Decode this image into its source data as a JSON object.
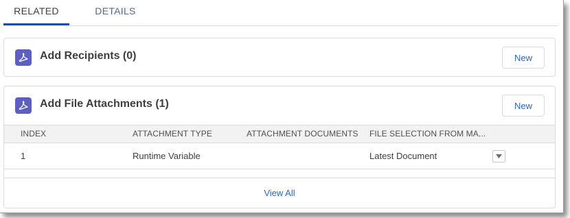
{
  "tabs": [
    {
      "label": "RELATED",
      "active": true
    },
    {
      "label": "DETAILS",
      "active": false
    }
  ],
  "recipients_card": {
    "title": "Add Recipients (0)",
    "icon": "pdf-icon",
    "new_label": "New"
  },
  "attachments_card": {
    "title": "Add File Attachments (1)",
    "icon": "pdf-icon",
    "new_label": "New",
    "columns": [
      "INDEX",
      "ATTACHMENT TYPE",
      "ATTACHMENT DOCUMENTS",
      "FILE SELECTION FROM MA..."
    ],
    "rows": [
      {
        "index": "1",
        "attachment_type": "Runtime Variable",
        "attachment_documents": "",
        "file_selection": "Latest Document"
      }
    ],
    "view_all_label": "View All"
  },
  "colors": {
    "accent": "#1b5297",
    "icon_bg": "#5d5fbf",
    "link": "#2a68b8",
    "header_bg": "#f3f2f2",
    "border": "#dddbda"
  }
}
